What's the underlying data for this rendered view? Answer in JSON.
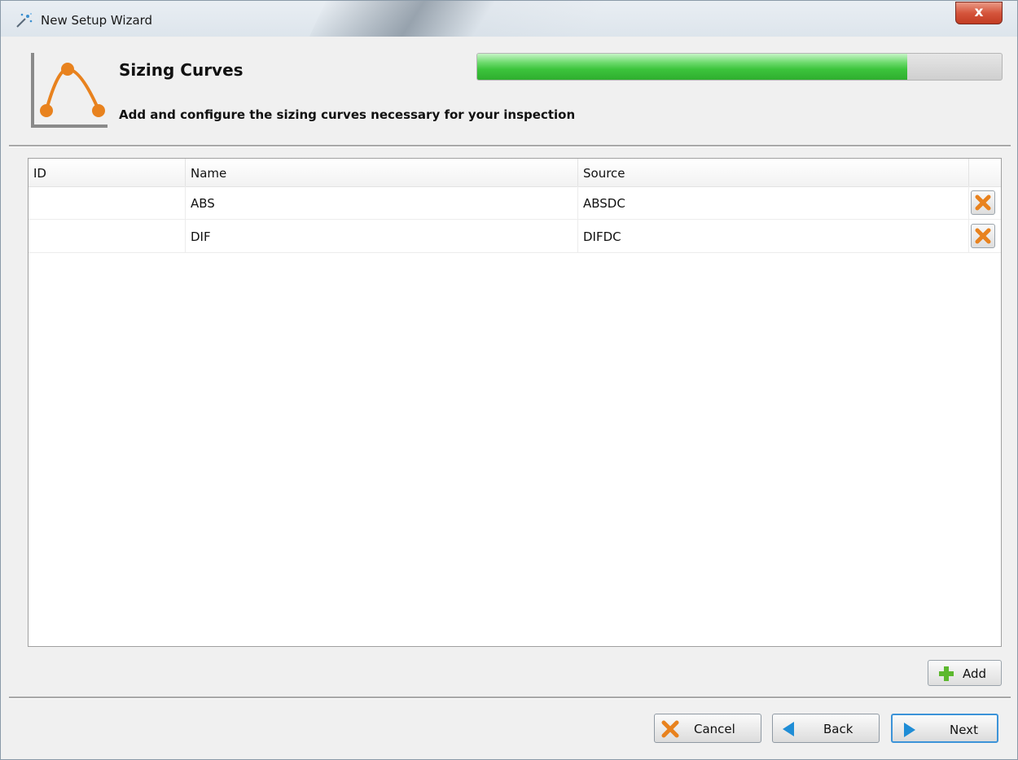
{
  "window": {
    "title": "New Setup Wizard",
    "close_label": "x"
  },
  "header": {
    "title": "Sizing Curves",
    "subtitle": "Add and configure the sizing curves necessary for your inspection",
    "progress_percent": 82
  },
  "table": {
    "columns": [
      "ID",
      "Name",
      "Source"
    ],
    "rows": [
      {
        "id": "",
        "name": "ABS",
        "source": "ABSDC"
      },
      {
        "id": "",
        "name": "DIF",
        "source": "DIFDC"
      }
    ]
  },
  "actions": {
    "add_label": "Add"
  },
  "footer": {
    "cancel_label": "Cancel",
    "back_label": "Back",
    "next_label": "Next"
  },
  "colors": {
    "accent_orange": "#e8821e",
    "progress_green": "#3cc43c",
    "nav_blue": "#1f8dd6",
    "add_green": "#5cb82e"
  },
  "icons": {
    "title": "magic-wand-icon",
    "header": "sizing-curve-icon",
    "row_delete": "delete-x-icon",
    "add": "plus-icon",
    "cancel": "cancel-x-icon",
    "back": "arrow-left-icon",
    "next": "arrow-right-icon"
  }
}
